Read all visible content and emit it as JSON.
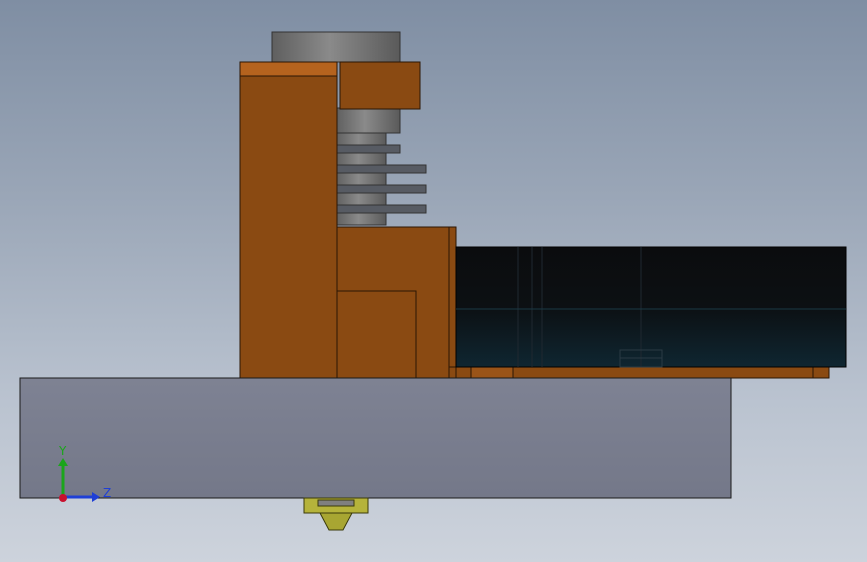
{
  "triad": {
    "y_label": "Y",
    "z_label": "Z"
  },
  "colors": {
    "copper": "#8a4a12",
    "copper_top": "#b5631e",
    "steel": "#767a8a",
    "fin": "#4f5560",
    "cylinder": "#6e6e6e",
    "dark_block": "#0b0f12",
    "nozzle": "#b5b33b",
    "axis_y": "#1ba51b",
    "axis_z": "#1f3fd6",
    "axis_origin": "#c8102e"
  }
}
